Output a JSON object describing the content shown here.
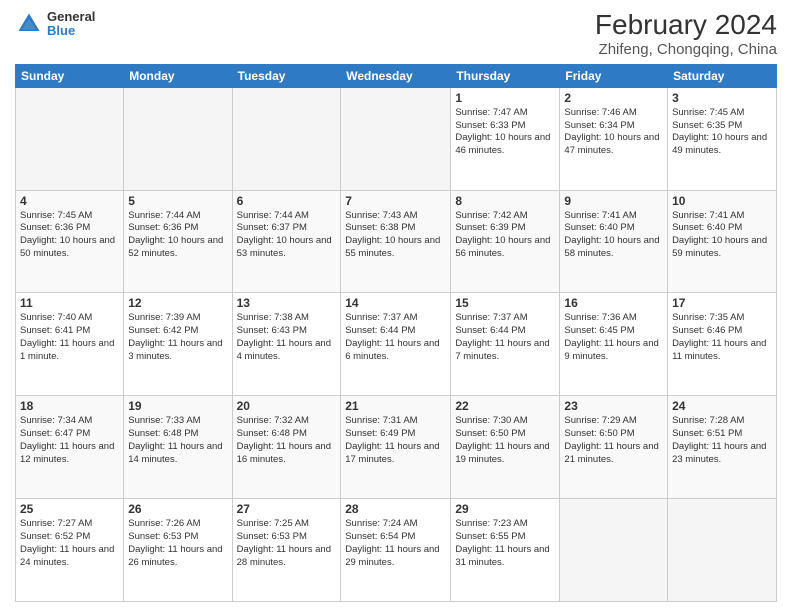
{
  "logo": {
    "line1": "General",
    "line2": "Blue"
  },
  "title": "February 2024",
  "subtitle": "Zhifeng, Chongqing, China",
  "days_of_week": [
    "Sunday",
    "Monday",
    "Tuesday",
    "Wednesday",
    "Thursday",
    "Friday",
    "Saturday"
  ],
  "weeks": [
    [
      {
        "day": "",
        "empty": true
      },
      {
        "day": "",
        "empty": true
      },
      {
        "day": "",
        "empty": true
      },
      {
        "day": "",
        "empty": true
      },
      {
        "day": "1",
        "sunrise": "7:47 AM",
        "sunset": "6:33 PM",
        "daylight": "10 hours and 46 minutes."
      },
      {
        "day": "2",
        "sunrise": "7:46 AM",
        "sunset": "6:34 PM",
        "daylight": "10 hours and 47 minutes."
      },
      {
        "day": "3",
        "sunrise": "7:45 AM",
        "sunset": "6:35 PM",
        "daylight": "10 hours and 49 minutes."
      }
    ],
    [
      {
        "day": "4",
        "sunrise": "7:45 AM",
        "sunset": "6:36 PM",
        "daylight": "10 hours and 50 minutes."
      },
      {
        "day": "5",
        "sunrise": "7:44 AM",
        "sunset": "6:36 PM",
        "daylight": "10 hours and 52 minutes."
      },
      {
        "day": "6",
        "sunrise": "7:44 AM",
        "sunset": "6:37 PM",
        "daylight": "10 hours and 53 minutes."
      },
      {
        "day": "7",
        "sunrise": "7:43 AM",
        "sunset": "6:38 PM",
        "daylight": "10 hours and 55 minutes."
      },
      {
        "day": "8",
        "sunrise": "7:42 AM",
        "sunset": "6:39 PM",
        "daylight": "10 hours and 56 minutes."
      },
      {
        "day": "9",
        "sunrise": "7:41 AM",
        "sunset": "6:40 PM",
        "daylight": "10 hours and 58 minutes."
      },
      {
        "day": "10",
        "sunrise": "7:41 AM",
        "sunset": "6:40 PM",
        "daylight": "10 hours and 59 minutes."
      }
    ],
    [
      {
        "day": "11",
        "sunrise": "7:40 AM",
        "sunset": "6:41 PM",
        "daylight": "11 hours and 1 minute."
      },
      {
        "day": "12",
        "sunrise": "7:39 AM",
        "sunset": "6:42 PM",
        "daylight": "11 hours and 3 minutes."
      },
      {
        "day": "13",
        "sunrise": "7:38 AM",
        "sunset": "6:43 PM",
        "daylight": "11 hours and 4 minutes."
      },
      {
        "day": "14",
        "sunrise": "7:37 AM",
        "sunset": "6:44 PM",
        "daylight": "11 hours and 6 minutes."
      },
      {
        "day": "15",
        "sunrise": "7:37 AM",
        "sunset": "6:44 PM",
        "daylight": "11 hours and 7 minutes."
      },
      {
        "day": "16",
        "sunrise": "7:36 AM",
        "sunset": "6:45 PM",
        "daylight": "11 hours and 9 minutes."
      },
      {
        "day": "17",
        "sunrise": "7:35 AM",
        "sunset": "6:46 PM",
        "daylight": "11 hours and 11 minutes."
      }
    ],
    [
      {
        "day": "18",
        "sunrise": "7:34 AM",
        "sunset": "6:47 PM",
        "daylight": "11 hours and 12 minutes."
      },
      {
        "day": "19",
        "sunrise": "7:33 AM",
        "sunset": "6:48 PM",
        "daylight": "11 hours and 14 minutes."
      },
      {
        "day": "20",
        "sunrise": "7:32 AM",
        "sunset": "6:48 PM",
        "daylight": "11 hours and 16 minutes."
      },
      {
        "day": "21",
        "sunrise": "7:31 AM",
        "sunset": "6:49 PM",
        "daylight": "11 hours and 17 minutes."
      },
      {
        "day": "22",
        "sunrise": "7:30 AM",
        "sunset": "6:50 PM",
        "daylight": "11 hours and 19 minutes."
      },
      {
        "day": "23",
        "sunrise": "7:29 AM",
        "sunset": "6:50 PM",
        "daylight": "11 hours and 21 minutes."
      },
      {
        "day": "24",
        "sunrise": "7:28 AM",
        "sunset": "6:51 PM",
        "daylight": "11 hours and 23 minutes."
      }
    ],
    [
      {
        "day": "25",
        "sunrise": "7:27 AM",
        "sunset": "6:52 PM",
        "daylight": "11 hours and 24 minutes."
      },
      {
        "day": "26",
        "sunrise": "7:26 AM",
        "sunset": "6:53 PM",
        "daylight": "11 hours and 26 minutes."
      },
      {
        "day": "27",
        "sunrise": "7:25 AM",
        "sunset": "6:53 PM",
        "daylight": "11 hours and 28 minutes."
      },
      {
        "day": "28",
        "sunrise": "7:24 AM",
        "sunset": "6:54 PM",
        "daylight": "11 hours and 29 minutes."
      },
      {
        "day": "29",
        "sunrise": "7:23 AM",
        "sunset": "6:55 PM",
        "daylight": "11 hours and 31 minutes."
      },
      {
        "day": "",
        "empty": true
      },
      {
        "day": "",
        "empty": true
      }
    ]
  ],
  "labels": {
    "sunrise": "Sunrise:",
    "sunset": "Sunset:",
    "daylight": "Daylight:"
  }
}
